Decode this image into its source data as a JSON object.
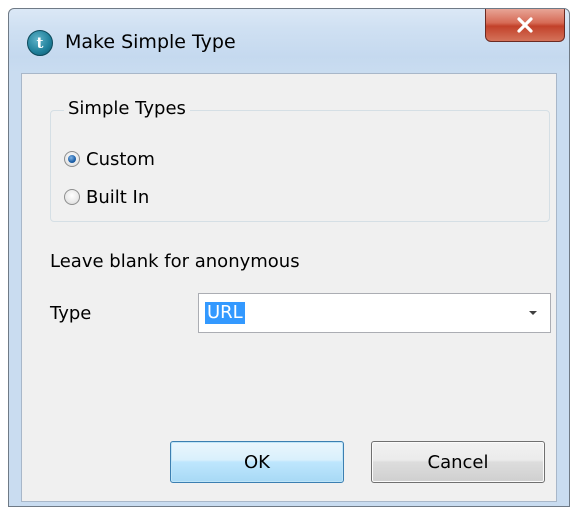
{
  "window": {
    "title": "Make Simple Type",
    "app_icon_glyph": "t",
    "close_icon": "close-icon"
  },
  "simple_types": {
    "legend": "Simple Types",
    "options": [
      {
        "label": "Custom",
        "checked": true
      },
      {
        "label": "Built In",
        "checked": false
      }
    ]
  },
  "hint": "Leave blank for anonymous",
  "type_field": {
    "label": "Type",
    "value": "URL",
    "arrow_icon": "dropdown-arrow-icon"
  },
  "buttons": {
    "ok": "OK",
    "cancel": "Cancel"
  },
  "colors": {
    "selection": "#3399ff",
    "close_button": "#c2412a",
    "default_button_border": "#3c7fb1"
  }
}
